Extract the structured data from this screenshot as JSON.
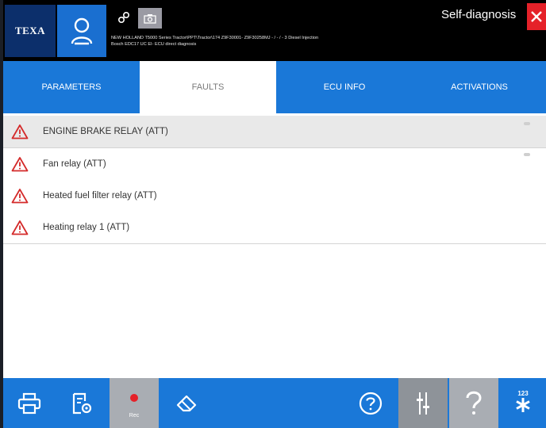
{
  "header": {
    "logo_text": "TEXA",
    "title": "Self-diagnosis",
    "vehicle_line1": "NEW HOLLAND T5000 Series Tractor\\PPT\\Tractor\\174 Z9F30001- Z9F30258MJ - / - / - 3 Diesel Injection",
    "vehicle_line2": "Bosch EDC17 UC EI- ECU direct diagnosis"
  },
  "tabs": [
    {
      "label": "PARAMETERS",
      "active": false
    },
    {
      "label": "FAULTS",
      "active": true
    },
    {
      "label": "ECU INFO",
      "active": false
    },
    {
      "label": "ACTIVATIONS",
      "active": false
    }
  ],
  "faults": [
    {
      "label": "ENGINE BRAKE RELAY (ATT)",
      "selected": true
    },
    {
      "label": "Fan relay (ATT)",
      "selected": false
    },
    {
      "label": "Heated fuel filter relay (ATT)",
      "selected": false
    },
    {
      "label": "Heating relay 1 (ATT)",
      "selected": false
    }
  ],
  "toolbar": {
    "rec_label": "Rec",
    "numpad_label": "123"
  },
  "colors": {
    "accent_blue": "#1a78d8",
    "logo_navy": "#0c2f6b",
    "close_red": "#e52129",
    "warning_red": "#d42a2a"
  },
  "icons": [
    "user-icon",
    "link-icon",
    "camera-icon",
    "close-icon",
    "warning-icon",
    "printer-icon",
    "report-settings-icon",
    "record-icon",
    "eraser-icon",
    "help-circle-icon",
    "sliders-icon",
    "question-icon",
    "numpad-icon"
  ]
}
